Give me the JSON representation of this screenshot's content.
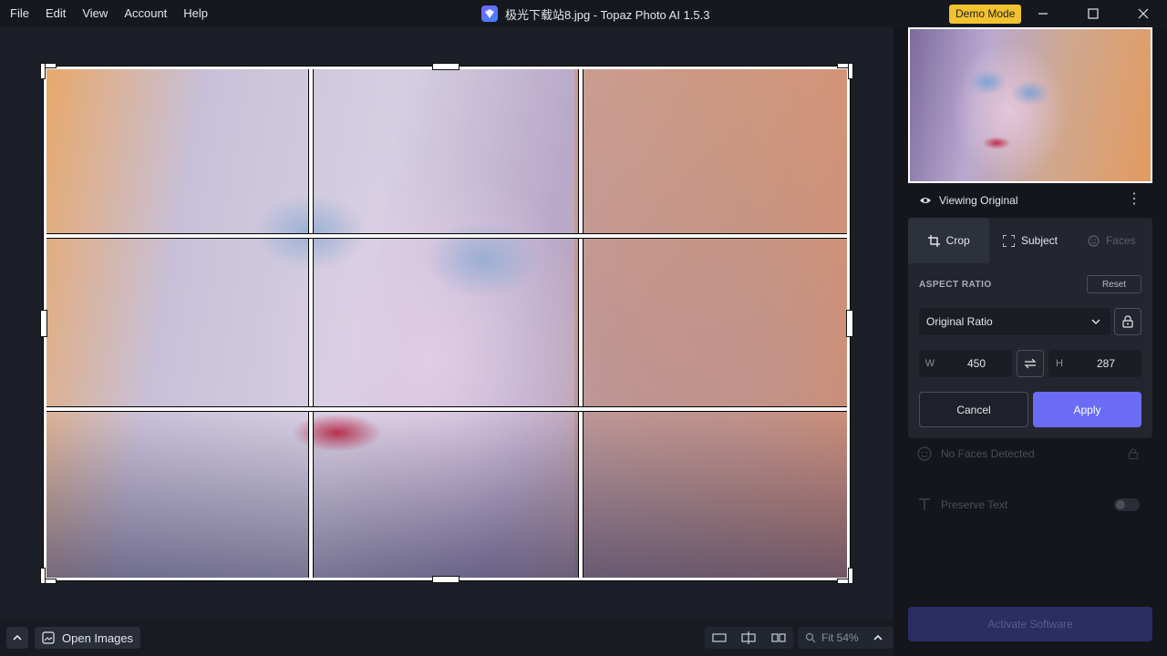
{
  "menu": [
    "File",
    "Edit",
    "View",
    "Account",
    "Help"
  ],
  "window": {
    "title": "极光下载站8.jpg - Topaz Photo AI 1.5.3",
    "demo_badge": "Demo Mode"
  },
  "canvas": {
    "grid": "rule-of-thirds"
  },
  "bottombar": {
    "open_images": "Open Images",
    "zoom": "Fit 54%"
  },
  "side": {
    "viewing": "Viewing Original",
    "tabs": [
      {
        "label": "Crop",
        "active": true
      },
      {
        "label": "Subject",
        "active": false
      },
      {
        "label": "Faces",
        "disabled": true
      }
    ],
    "aspect_ratio_label": "ASPECT RATIO",
    "reset_label": "Reset",
    "ratio_value": "Original Ratio",
    "width_label": "W",
    "width_value": "450",
    "height_label": "H",
    "height_value": "287",
    "cancel_label": "Cancel",
    "apply_label": "Apply",
    "no_faces": "No Faces Detected",
    "preserve_text": "Preserve Text",
    "activate": "Activate Software"
  },
  "colors": {
    "accent": "#6a6cf6",
    "demo": "#f2c230",
    "background": "#1b1e26"
  }
}
